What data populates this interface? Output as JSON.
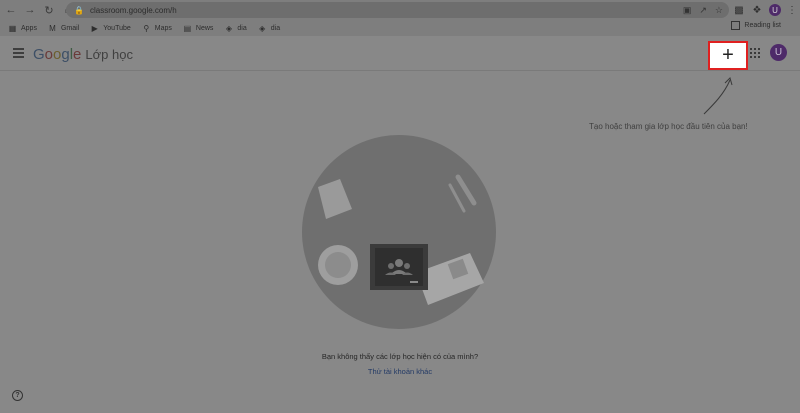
{
  "browser": {
    "url": "classroom.google.com/h",
    "profile_initial": "U",
    "bookmarks": [
      {
        "label": "Apps",
        "icon": "apps-grid-icon"
      },
      {
        "label": "Gmail",
        "icon": "gmail-icon"
      },
      {
        "label": "YouTube",
        "icon": "youtube-icon"
      },
      {
        "label": "Maps",
        "icon": "maps-icon"
      },
      {
        "label": "News",
        "icon": "news-icon"
      },
      {
        "label": "dia",
        "icon": "dia-icon"
      },
      {
        "label": "dia",
        "icon": "dia-icon"
      }
    ],
    "reading_list": "Reading list"
  },
  "appbar": {
    "logo_letters": [
      "G",
      "o",
      "o",
      "g",
      "l",
      "e"
    ],
    "product": "Lớp học",
    "add_symbol": "+",
    "avatar_initial": "U"
  },
  "hint": "Tạo hoặc tham gia lớp học đầu tiên của bạn!",
  "empty_state": {
    "title": "Bạn không thấy các lớp học hiện có của mình?",
    "link": "Thử tài khoản khác"
  },
  "help_symbol": "?",
  "colors": {
    "overlay": "#888888",
    "highlight_border": "#e02020",
    "avatar": "#4e2a69",
    "link": "#233a66"
  }
}
